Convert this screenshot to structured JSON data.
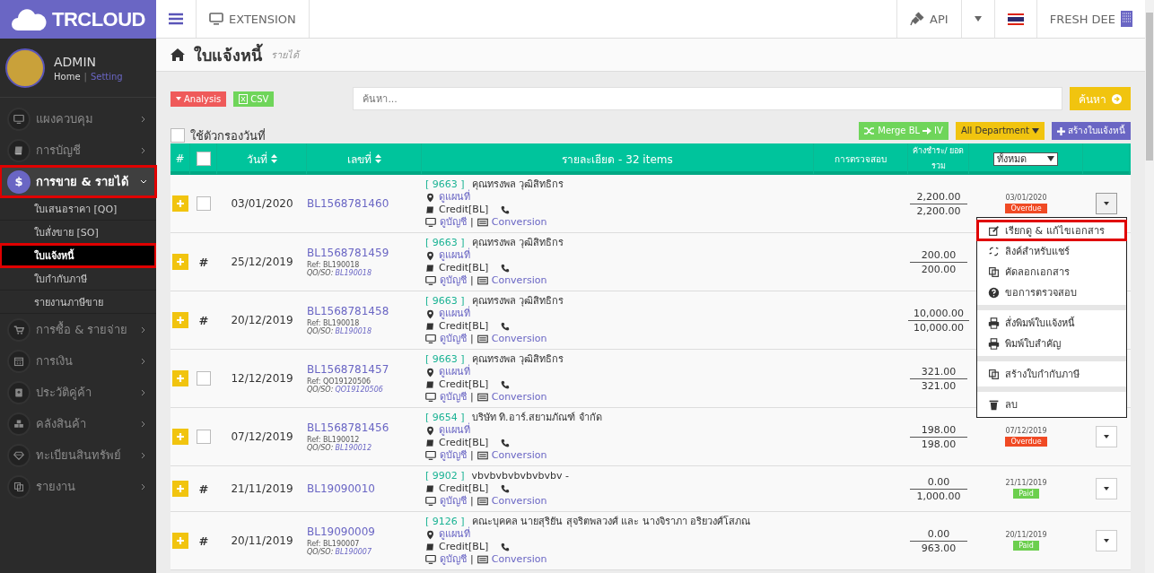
{
  "sidebar": {
    "logo": "TRCLOUD",
    "user": {
      "name": "ADMIN",
      "home_link": "Home",
      "separator": "|",
      "setting_link": "Setting"
    },
    "items": [
      {
        "label": "แผงควบคุม",
        "selected": false,
        "expanded": false,
        "highlighted": false
      },
      {
        "label": "การบัญชี",
        "selected": false,
        "expanded": false,
        "highlighted": false
      },
      {
        "label": "การขาย & รายได้",
        "glyph": "$",
        "selected": true,
        "expanded": true,
        "highlighted": true,
        "children": [
          {
            "label": "ใบเสนอราคา [QO]",
            "selected": false,
            "highlighted": false
          },
          {
            "label": "ใบสั่งขาย [SO]",
            "selected": false,
            "highlighted": false
          },
          {
            "label": "ใบแจ้งหนี้",
            "selected": true,
            "highlighted": true
          },
          {
            "label": "ใบกำกับภาษี",
            "selected": false,
            "highlighted": false
          },
          {
            "label": "รายงานภาษีขาย",
            "selected": false,
            "highlighted": false
          }
        ]
      },
      {
        "label": "การซื้อ & รายจ่าย",
        "selected": false,
        "expanded": false,
        "highlighted": false
      },
      {
        "label": "การเงิน",
        "selected": false,
        "expanded": false,
        "highlighted": false
      },
      {
        "label": "ประวัติคู่ค้า",
        "selected": false,
        "expanded": false,
        "highlighted": false
      },
      {
        "label": "คลังสินค้า",
        "selected": false,
        "expanded": false,
        "highlighted": false
      },
      {
        "label": "ทะเบียนสินทรัพย์",
        "selected": false,
        "expanded": false,
        "highlighted": false
      },
      {
        "label": "รายงาน",
        "selected": false,
        "expanded": false,
        "highlighted": false
      }
    ]
  },
  "topbar": {
    "extension": "EXTENSION",
    "api": "API",
    "company": "FRESH DEE"
  },
  "page": {
    "title": "ใบแจ้งหนี้",
    "subtitle": "รายได้"
  },
  "toolbar": {
    "analysis": "Analysis",
    "csv": "CSV",
    "search": {
      "placeholder": "ค้นหา..."
    },
    "search_button": "ค้นหา"
  },
  "filter": {
    "date_filter": {
      "label": "ใช้ตัวกรองวันที่",
      "checked": false
    },
    "merge": "Merge BL",
    "merge_target": "IV",
    "department": "All Department",
    "create": "สร้างใบแจ้งหนี้"
  },
  "table": {
    "columns": {
      "hash": "#",
      "select_all_checked": false,
      "date": "วันที่",
      "number": "เลขที่",
      "details": "รายละเอียด - 32 items",
      "inspection": "การตรวจสอบ",
      "amount": "ค้างชำระ/ ยอดรวม",
      "status_filter": "ทั้งหมด"
    },
    "rows": [
      {
        "kind": "checkbox",
        "checked": false,
        "date": "03/01/2020",
        "number": "BL1568781460",
        "code": "[ 9663 ]",
        "name": "คุณทรงพล วุฒิสิทธิกร",
        "map": "ดูแผนที่",
        "credit": "Credit[BL]",
        "account": "ดูบัญชี",
        "separator": "|",
        "conversion": "Conversion",
        "outstanding": "2,200.00",
        "total": "2,200.00",
        "status_date": "03/01/2020",
        "status": "Overdue",
        "color": "#f04a24",
        "menu_open": true
      },
      {
        "kind": "hash",
        "marker": "#",
        "date": "25/12/2019",
        "number": "BL1568781459",
        "ref": "Ref: BL190018",
        "qo_so_label": "QO/SO:",
        "qo_so": "BL190018",
        "code": "[ 9663 ]",
        "name": "คุณทรงพล วุฒิสิทธิกร",
        "map": "ดูแผนที่",
        "credit": "Credit[BL]",
        "account": "ดูบัญชี",
        "separator": "|",
        "conversion": "Conversion",
        "outstanding": "200.00",
        "total": "200.00"
      },
      {
        "kind": "hash",
        "marker": "#",
        "date": "20/12/2019",
        "number": "BL1568781458",
        "ref": "Ref: BL190018",
        "qo_so_label": "QO/SO:",
        "qo_so": "BL190018",
        "code": "[ 9663 ]",
        "name": "คุณทรงพล วุฒิสิทธิกร",
        "map": "ดูแผนที่",
        "credit": "Credit[BL]",
        "account": "ดูบัญชี",
        "separator": "|",
        "conversion": "Conversion",
        "outstanding": "10,000.00",
        "total": "10,000.00"
      },
      {
        "kind": "checkbox",
        "checked": false,
        "date": "12/12/2019",
        "number": "BL1568781457",
        "ref": "Ref: QO19120506",
        "qo_so_label": "QO/SO:",
        "qo_so": "QO19120506",
        "code": "[ 9663 ]",
        "name": "คุณทรงพล วุฒิสิทธิกร",
        "map": "ดูแผนที่",
        "credit": "Credit[BL]",
        "account": "ดูบัญชี",
        "separator": "|",
        "conversion": "Conversion",
        "outstanding": "321.00",
        "total": "321.00"
      },
      {
        "kind": "checkbox",
        "checked": false,
        "date": "07/12/2019",
        "number": "BL1568781456",
        "ref": "Ref: BL190012",
        "qo_so_label": "QO/SO:",
        "qo_so": "BL190012",
        "code": "[ 9654 ]",
        "name": "บริษัท ทิ.อาร์.สยามภัณฑ์ จำกัด",
        "map": "ดูแผนที่",
        "credit": "Credit[BL]",
        "account": "ดูบัญชี",
        "separator": "|",
        "conversion": "Conversion",
        "outstanding": "198.00",
        "total": "198.00",
        "status_date": "07/12/2019",
        "status": "Overdue",
        "color": "#f04a24",
        "menu_open": false
      },
      {
        "kind": "hash",
        "marker": "#",
        "date": "21/11/2019",
        "number": "BL19090010",
        "code": "[ 9902 ]",
        "name": "vbvbvbvbvbvbvbv -",
        "credit": "Credit[BL]",
        "account": "ดูบัญชี",
        "separator": "|",
        "conversion": "Conversion",
        "outstanding": "0.00",
        "total": "1,000.00",
        "status_date": "21/11/2019",
        "status": "Paid",
        "color": "#6ccf4e",
        "menu_open": false
      },
      {
        "kind": "hash",
        "marker": "#",
        "date": "20/11/2019",
        "number": "BL19090009",
        "ref": "Ref: BL190007",
        "qo_so_label": "QO/SO:",
        "qo_so": "BL190007",
        "code": "[ 9126 ]",
        "name": "คณะบุคคล นายสุริยัน สุจริตพลวงศ์ และ นางจิราภา อริยวงศ์โสภณ",
        "map": "ดูแผนที่",
        "credit": "Credit[BL]",
        "account": "ดูบัญชี",
        "separator": "|",
        "conversion": "Conversion",
        "outstanding": "0.00",
        "total": "963.00",
        "status_date": "20/11/2019",
        "status": "Paid",
        "color": "#6ccf4e",
        "menu_open": false
      }
    ]
  },
  "row_menu": {
    "groups": [
      [
        {
          "label": "เรียกดู & แก้ไขเอกสาร",
          "highlighted": true
        },
        {
          "label": "ลิงค์สำหรับแชร์",
          "highlighted": false
        },
        {
          "label": "คัดลอกเอกสาร",
          "highlighted": false
        },
        {
          "label": "ขอการตรวจสอบ",
          "highlighted": false
        }
      ],
      [
        {
          "label": "สั่งพิมพ์ใบแจ้งหนี้",
          "highlighted": false
        },
        {
          "label": "พิมพ์ใบสำคัญ",
          "highlighted": false
        }
      ],
      [
        {
          "label": "สร้างใบกำกับภาษี",
          "highlighted": false
        }
      ],
      [
        {
          "label": "ลบ",
          "highlighted": false
        }
      ]
    ]
  }
}
